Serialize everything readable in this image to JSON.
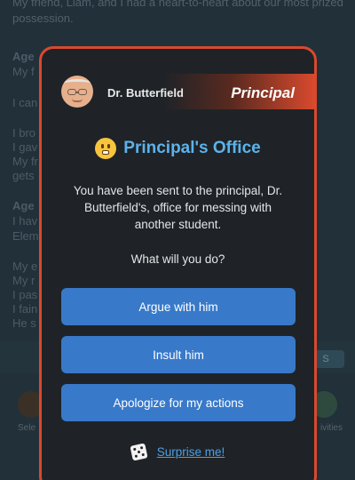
{
  "background": {
    "top_text": "My friend, Liam, and I had a heart-to-heart about our most prized possession.",
    "label_1": "Age",
    "row_a": "My f",
    "row_b": "I can",
    "row_c": "I bro",
    "row_d": "I gav",
    "row_e": "My fr",
    "row_f": "gets",
    "label_2": "Age",
    "row_g": "I hav",
    "row_h": "Elem",
    "row_i": "My e",
    "row_j": "My r",
    "row_k": "I pas",
    "row_l": "I fain",
    "row_m": "He s",
    "button_text": "S",
    "left_small": "Sele",
    "right_small": "ivities"
  },
  "modal": {
    "character_name": "Dr. Butterfield",
    "character_role": "Principal",
    "title": "Principal's Office",
    "description": "You have been sent to the principal, Dr. Butterfield's, office for messing with another student.",
    "prompt": "What will you do?",
    "choices": [
      {
        "label": "Argue with him"
      },
      {
        "label": "Insult him"
      },
      {
        "label": "Apologize for my actions"
      }
    ],
    "surprise_label": "Surprise me!"
  },
  "colors": {
    "border": "#d8492e",
    "title": "#5bb3ec",
    "button": "#3879c9",
    "link": "#4e9fe3",
    "modal_bg": "#1f2327"
  },
  "icons": {
    "avatar": "dr-butterfield-avatar",
    "title_emoji": "grimacing-face-icon",
    "dice": "dice-icon"
  }
}
